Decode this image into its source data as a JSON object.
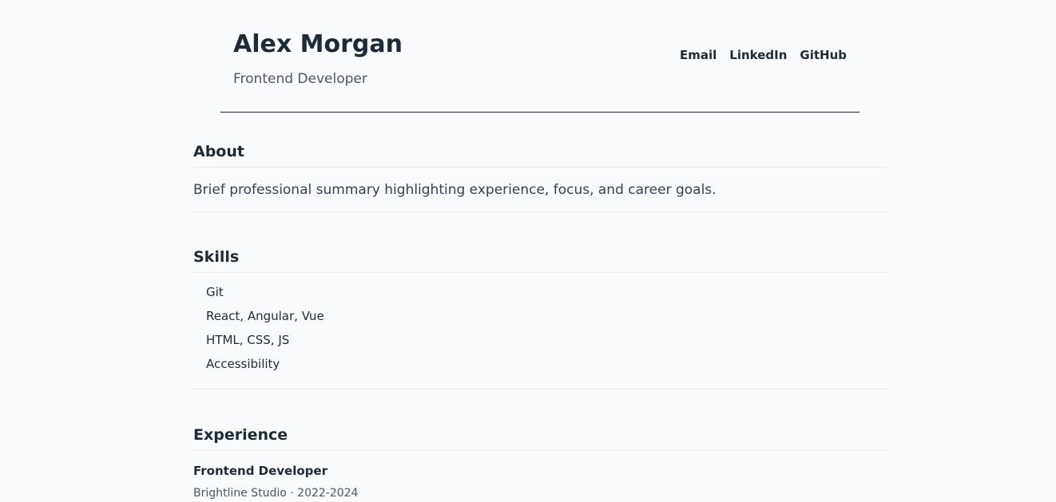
{
  "header": {
    "name": "Alex Morgan",
    "role": "Frontend Developer",
    "links": {
      "email": "Email",
      "linkedin": "LinkedIn",
      "github": "GitHub"
    }
  },
  "about": {
    "title": "About",
    "text": "Brief professional summary highlighting experience, focus, and career goals."
  },
  "skills": {
    "title": "Skills",
    "items": [
      "Git",
      "React, Angular, Vue",
      "HTML, CSS, JS",
      "Accessibility"
    ]
  },
  "experience": {
    "title": "Experience",
    "items": [
      {
        "title": "Frontend Developer",
        "meta": "Brightline Studio · 2022-2024"
      }
    ]
  }
}
